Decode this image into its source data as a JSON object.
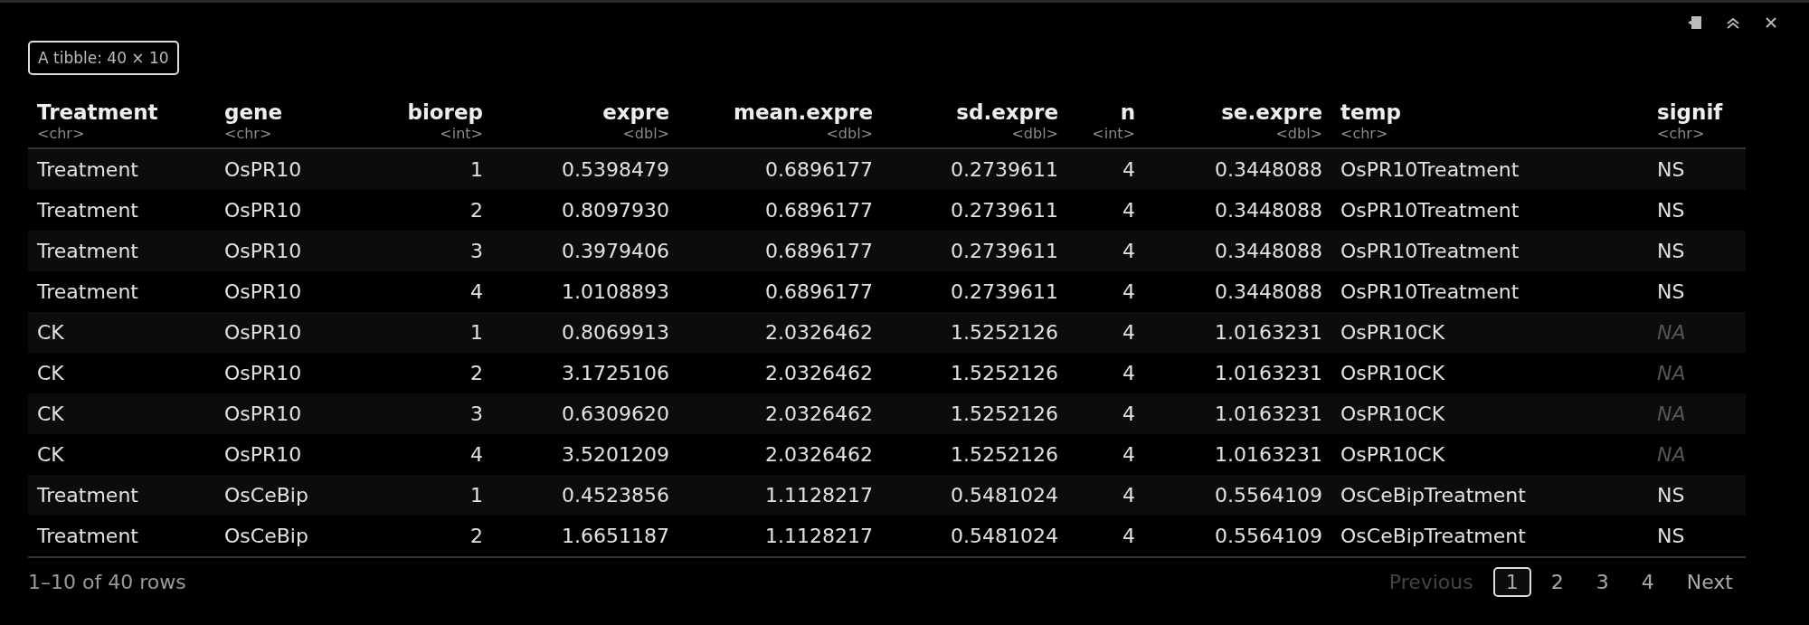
{
  "toolbar": {
    "buttons": [
      {
        "kind": "popout"
      },
      {
        "kind": "collapse"
      },
      {
        "kind": "close"
      }
    ]
  },
  "caption": "A tibble: 40 × 10",
  "table": {
    "columns": [
      {
        "name": "Treatment",
        "type": "<chr>",
        "numeric": false
      },
      {
        "name": "gene",
        "type": "<chr>",
        "numeric": false
      },
      {
        "name": "biorep",
        "type": "<int>",
        "numeric": true
      },
      {
        "name": "expre",
        "type": "<dbl>",
        "numeric": true
      },
      {
        "name": "mean.expre",
        "type": "<dbl>",
        "numeric": true
      },
      {
        "name": "sd.expre",
        "type": "<dbl>",
        "numeric": true
      },
      {
        "name": "n",
        "type": "<int>",
        "numeric": true
      },
      {
        "name": "se.expre",
        "type": "<dbl>",
        "numeric": true
      },
      {
        "name": "temp",
        "type": "<chr>",
        "numeric": false
      },
      {
        "name": "signif",
        "type": "<chr>",
        "numeric": false
      }
    ],
    "rows": [
      {
        "cells": [
          "Treatment",
          "OsPR10",
          "1",
          "0.5398479",
          "0.6896177",
          "0.2739611",
          "4",
          "0.3448088",
          "OsPR10Treatment",
          "NS"
        ],
        "signif_missing": false
      },
      {
        "cells": [
          "Treatment",
          "OsPR10",
          "2",
          "0.8097930",
          "0.6896177",
          "0.2739611",
          "4",
          "0.3448088",
          "OsPR10Treatment",
          "NS"
        ],
        "signif_missing": false
      },
      {
        "cells": [
          "Treatment",
          "OsPR10",
          "3",
          "0.3979406",
          "0.6896177",
          "0.2739611",
          "4",
          "0.3448088",
          "OsPR10Treatment",
          "NS"
        ],
        "signif_missing": false
      },
      {
        "cells": [
          "Treatment",
          "OsPR10",
          "4",
          "1.0108893",
          "0.6896177",
          "0.2739611",
          "4",
          "0.3448088",
          "OsPR10Treatment",
          "NS"
        ],
        "signif_missing": false
      },
      {
        "cells": [
          "CK",
          "OsPR10",
          "1",
          "0.8069913",
          "2.0326462",
          "1.5252126",
          "4",
          "1.0163231",
          "OsPR10CK",
          "NA"
        ],
        "signif_missing": true
      },
      {
        "cells": [
          "CK",
          "OsPR10",
          "2",
          "3.1725106",
          "2.0326462",
          "1.5252126",
          "4",
          "1.0163231",
          "OsPR10CK",
          "NA"
        ],
        "signif_missing": true
      },
      {
        "cells": [
          "CK",
          "OsPR10",
          "3",
          "0.6309620",
          "2.0326462",
          "1.5252126",
          "4",
          "1.0163231",
          "OsPR10CK",
          "NA"
        ],
        "signif_missing": true
      },
      {
        "cells": [
          "CK",
          "OsPR10",
          "4",
          "3.5201209",
          "2.0326462",
          "1.5252126",
          "4",
          "1.0163231",
          "OsPR10CK",
          "NA"
        ],
        "signif_missing": true
      },
      {
        "cells": [
          "Treatment",
          "OsCeBip",
          "1",
          "0.4523856",
          "1.1128217",
          "0.5481024",
          "4",
          "0.5564109",
          "OsCeBipTreatment",
          "NS"
        ],
        "signif_missing": false
      },
      {
        "cells": [
          "Treatment",
          "OsCeBip",
          "2",
          "1.6651187",
          "1.1128217",
          "0.5481024",
          "4",
          "0.5564109",
          "OsCeBipTreatment",
          "NS"
        ],
        "signif_missing": false
      }
    ]
  },
  "footer": {
    "summary": "1–10 of 40 rows",
    "pagination": [
      {
        "label": "Previous",
        "disabled": true,
        "selected": false
      },
      {
        "label": "1",
        "disabled": false,
        "selected": true
      },
      {
        "label": "2",
        "disabled": false,
        "selected": false
      },
      {
        "label": "3",
        "disabled": false,
        "selected": false
      },
      {
        "label": "4",
        "disabled": false,
        "selected": false
      },
      {
        "label": "Next",
        "disabled": false,
        "selected": false
      }
    ]
  }
}
